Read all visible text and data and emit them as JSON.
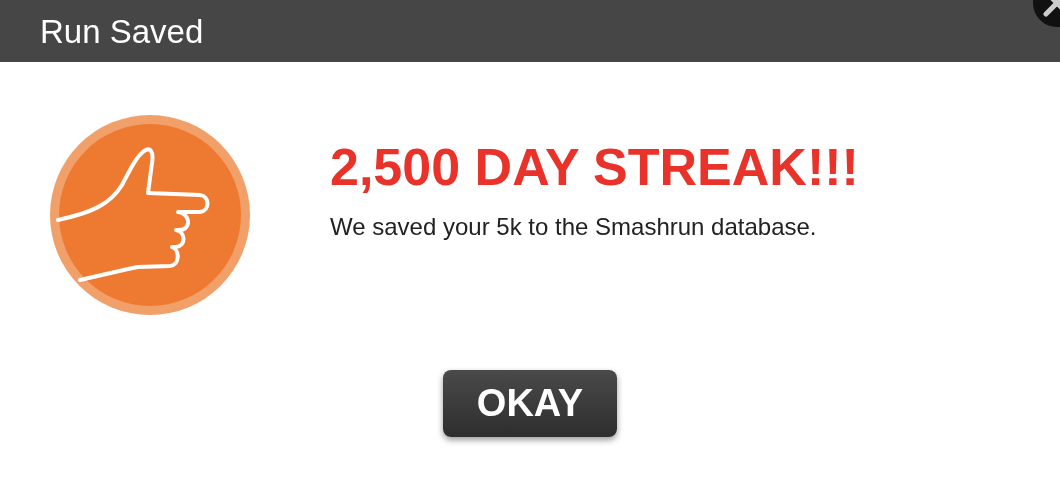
{
  "dialog": {
    "title": "Run Saved",
    "heading": "2,500 DAY STREAK!!!",
    "message": "We saved your 5k to the Smashrun database.",
    "button": "OKAY"
  }
}
